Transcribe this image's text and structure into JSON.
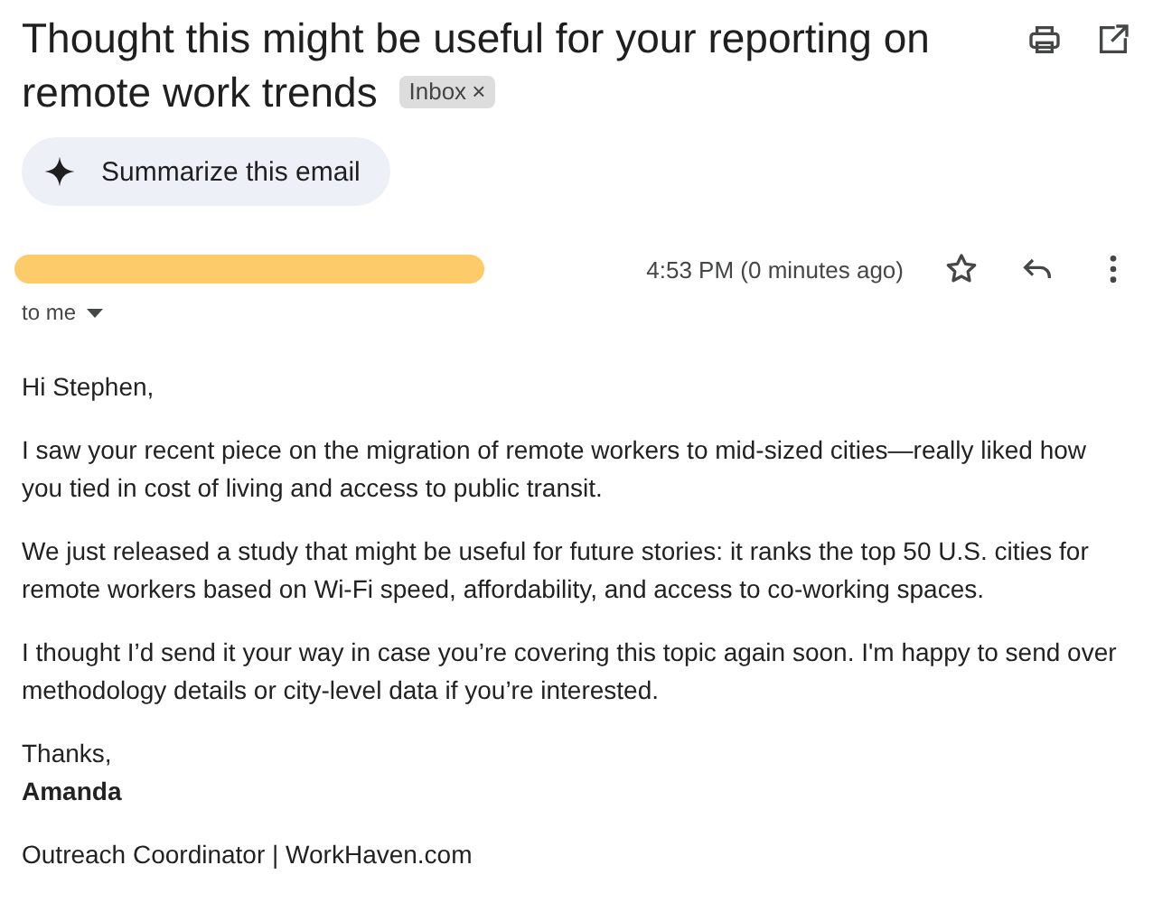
{
  "subject": "Thought this might be useful for your reporting on remote work trends",
  "labels": [
    {
      "text": "Inbox",
      "close": "×"
    }
  ],
  "summarize_button": "Summarize this email",
  "sender": {
    "redacted": true
  },
  "time": "4:53 PM (0 minutes ago)",
  "starred": false,
  "recipient": "to me",
  "body": {
    "greeting": "Hi Stephen,",
    "paragraphs": [
      "I saw your recent piece on the migration of remote workers to mid-sized cities—really liked how you tied in cost of living and access to public transit.",
      "We just released a study that might be useful for future stories: it ranks the top 50 U.S. cities for remote workers based on Wi-Fi speed, affordability, and access to co-working spaces.",
      "I thought I’d send it your way in case you’re covering this topic again soon. I'm happy to send over methodology details or city-level data if you’re interested."
    ],
    "closing": "Thanks,",
    "signature_name": "Amanda",
    "signature_title": "Outreach Coordinator | WorkHaven.com"
  }
}
